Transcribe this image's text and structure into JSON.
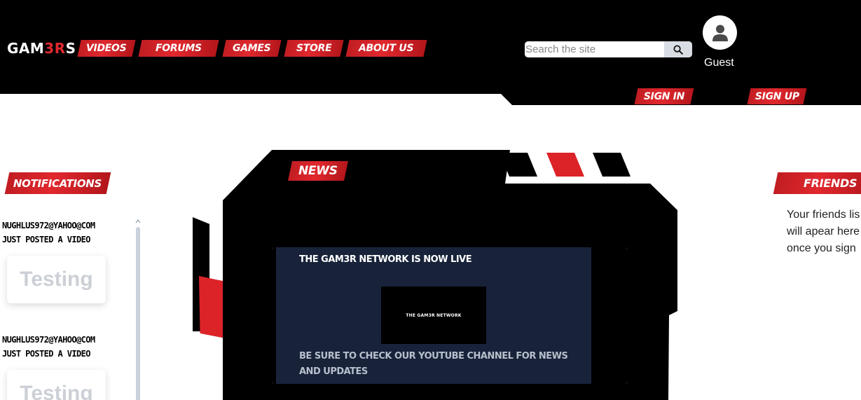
{
  "header": {
    "logo_main": "GAM",
    "logo_accent": "3R",
    "logo_end": "S",
    "nav": [
      {
        "label": "Videos"
      },
      {
        "label": "Forums"
      },
      {
        "label": "Games"
      },
      {
        "label": "Store"
      },
      {
        "label": "About Us"
      }
    ],
    "search": {
      "placeholder": "Search the site",
      "icon": "search-icon"
    },
    "user": {
      "avatar_icon": "user-icon",
      "name": "Guest"
    },
    "sign_in": "Sign In",
    "sign_up": "Sign Up"
  },
  "notifications": {
    "heading": "Notifications",
    "items": [
      {
        "user": "nughlus972@yahoo@com",
        "action": "just posted a video",
        "title": "Testing"
      },
      {
        "user": "nughlus972@yahoo@com",
        "action": "just posted a video",
        "title": "Testing"
      }
    ]
  },
  "news": {
    "heading": "News",
    "title": "The Gam3r Network is now live",
    "video_label": "The Gam3r Network",
    "body": "Be sure to check our youtube channel for news and updates"
  },
  "friends": {
    "heading": "Friends",
    "lines": [
      "Your friends lis",
      "will apear here",
      "once you sign"
    ]
  },
  "colors": {
    "accent": "#e0282e",
    "header_bg": "#000000",
    "card_bg": "#18233a"
  }
}
